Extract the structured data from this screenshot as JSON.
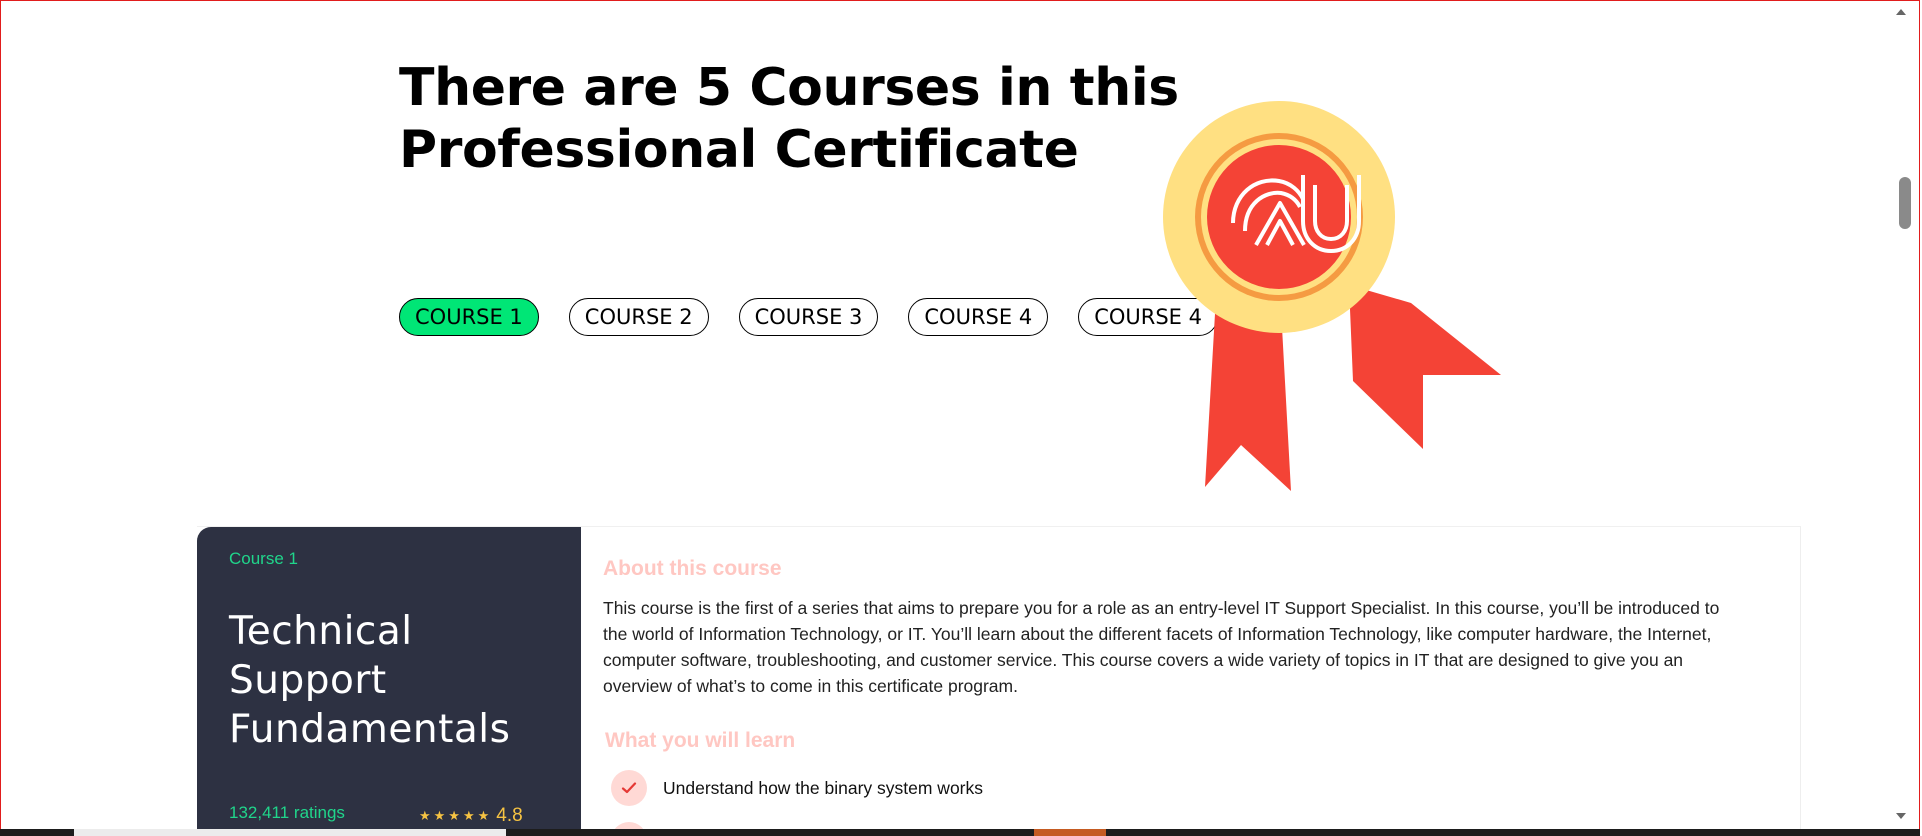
{
  "page": {
    "title": "There are 5 Courses in this Professional Certificate"
  },
  "tabs": [
    {
      "label": "COURSE 1",
      "active": true
    },
    {
      "label": "COURSE 2",
      "active": false
    },
    {
      "label": "COURSE 3",
      "active": false
    },
    {
      "label": "COURSE 4",
      "active": false
    },
    {
      "label": "COURSE 4",
      "active": false
    }
  ],
  "badge": {
    "icon": "award-ribbon-icon",
    "logo_text": "CAU"
  },
  "course": {
    "number_label": "Course 1",
    "name": "Technical Support Fundamentals",
    "ratings_count": "132,411 ratings",
    "rating_value": "4.8",
    "stars": "★★★★★",
    "about_title": "About this course",
    "about_text": "This course is the first of a series that aims to prepare you for a role as an entry-level IT Support Specialist. In this course, you’ll be introduced to the world of Information Technology, or IT. You’ll learn about the different facets of Information Technology, like computer hardware, the Internet, computer software, troubleshooting, and customer service. This course covers a wide variety of topics in IT that are designed to give you an overview of what’s to come in this certificate program.",
    "learn_title": "What you will learn",
    "learn_items": [
      "Understand how the binary system works"
    ]
  },
  "colors": {
    "active_tab": "#00e676",
    "course_panel": "#2d3142",
    "green_text": "#20d58b",
    "gold": "#f6c343",
    "coral_title": "#ffc7c2",
    "badge_red": "#f44336",
    "badge_gold": "#ffe082",
    "frame_border": "#e11d1d"
  }
}
